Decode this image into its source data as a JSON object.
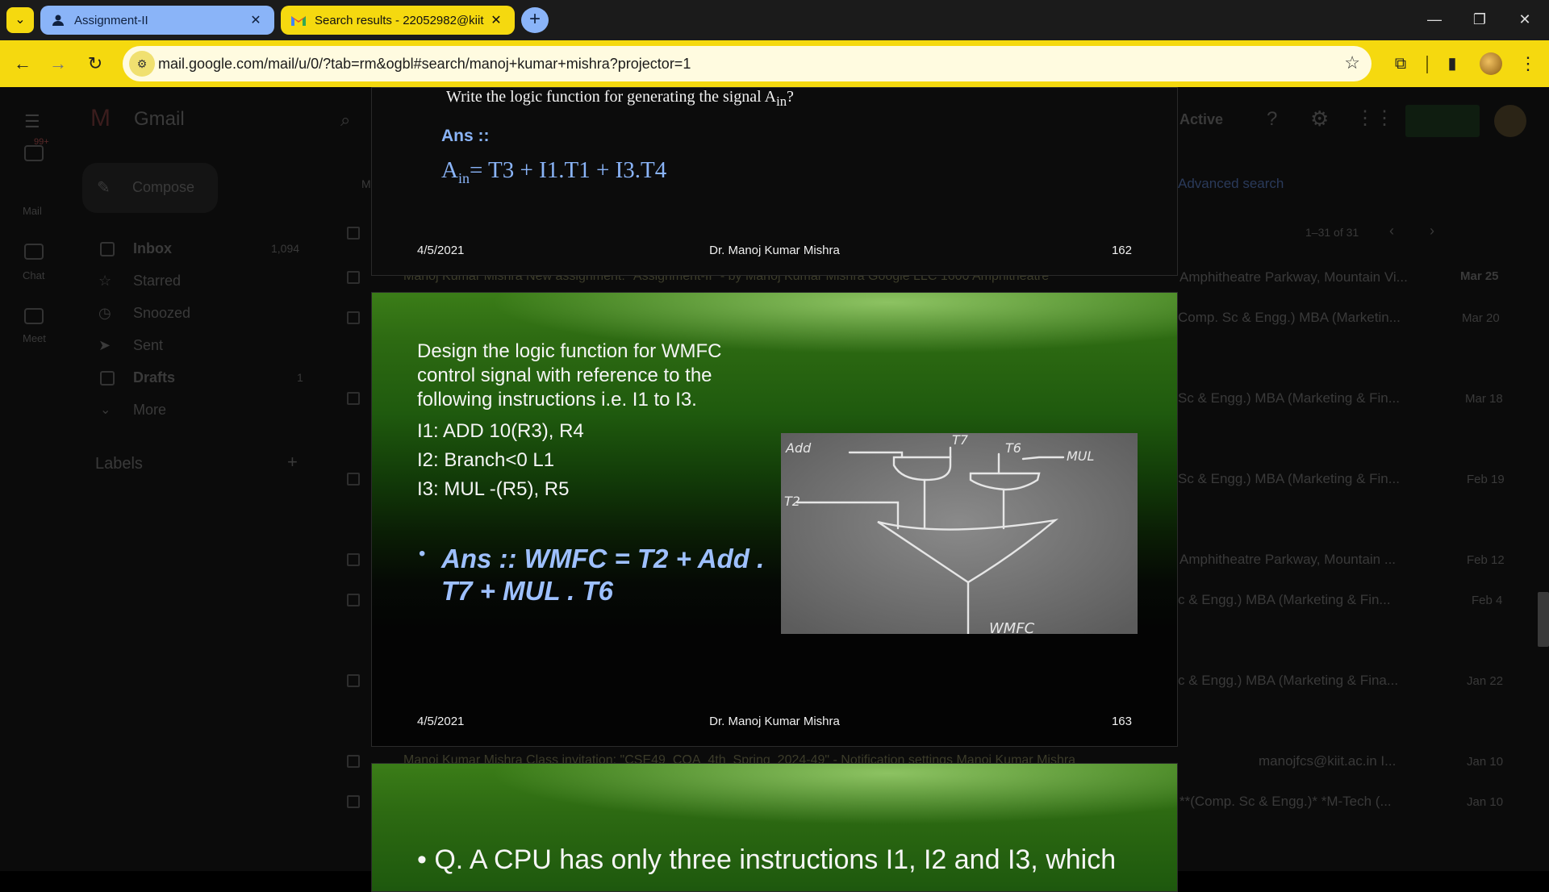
{
  "browser": {
    "tabs": [
      {
        "title": "Assignment-II",
        "icon": "person-icon",
        "active": false
      },
      {
        "title": "Search results - 22052982@kiit",
        "icon": "gmail-icon",
        "active": true
      }
    ],
    "url": "mail.google.com/mail/u/0/?tab=rm&ogbl#search/manoj+kumar+mishra?projector=1",
    "accent_color": "#f5d90f"
  },
  "gmail_bg": {
    "logo": "Gmail",
    "rail": [
      {
        "label": "Mail",
        "badge": "99+"
      },
      {
        "label": "Chat"
      },
      {
        "label": "Meet"
      }
    ],
    "compose": "Compose",
    "nav": [
      {
        "label": "Inbox",
        "count": "1,094"
      },
      {
        "label": "Starred",
        "count": ""
      },
      {
        "label": "Snoozed",
        "count": ""
      },
      {
        "label": "Sent",
        "count": ""
      },
      {
        "label": "Drafts",
        "count": "1"
      },
      {
        "label": "More",
        "count": ""
      }
    ],
    "labels_heading": "Labels",
    "status": "Active",
    "advanced_search": "Advanced search",
    "pagination": "1–31 of 31",
    "row_fragments": [
      "Amphitheatre Parkway, Mountain Vi...",
      "Comp. Sc & Engg.) MBA (Marketin...",
      "Sc & Engg.) MBA (Marketing & Fin...",
      "Sc & Engg.) MBA (Marketing & Fin...",
      "Amphitheatre Parkway, Mountain ...",
      "c & Engg.) MBA (Marketing & Fin...",
      "c & Engg.) MBA (Marketing & Fina...",
      "manojfcs@kiit.ac.in I...",
      "**(Comp. Sc & Engg.)* *M-Tech (..."
    ],
    "dates": [
      "Mar 25",
      "Mar 20",
      "Mar 18",
      "Feb 19",
      "Feb 12",
      "Feb 4",
      "Jan 22",
      "Jan 10",
      "Jan 10"
    ],
    "mid_row_1": "Manoj Kumar Mishra   New assignment: \"Assignment-II\" - by Manoj Kumar Mishra Google LLC 1600 Amphitheatre",
    "mid_row_2": "Manoj Kumar Mishra   Class invitation: \"CSE49_COA_4th_Spring_2024-49\" - Notification settings Manoj Kumar Mishra"
  },
  "slides": [
    {
      "question": "Write the logic function for generating the signal A",
      "question_sub": "in",
      "question_end": "?",
      "ans_label": "Ans ::",
      "eq_lhs": "A",
      "eq_sub": "in",
      "eq_rhs": "= T3 + I1.T1 + I3.T4",
      "date": "4/5/2021",
      "author": "Dr. Manoj Kumar Mishra",
      "page": "162"
    },
    {
      "body": "Design the logic function for WMFC control signal with reference to the following instructions i.e. I1 to I3.",
      "i1": "I1: ADD  10(R3), R4",
      "i2": "I2: Branch<0  L1",
      "i3": "I3: MUL  -(R5), R5",
      "bullet": "•",
      "answer": "Ans :: WMFC = T2 + Add . T7 + MUL . T6",
      "diagram": {
        "labels": [
          "Add",
          "T7",
          "T6",
          "MUL",
          "T2",
          "WMFC"
        ]
      },
      "date": "4/5/2021",
      "author": "Dr. Manoj Kumar Mishra",
      "page": "163"
    },
    {
      "text": "• Q. A CPU has only three instructions I1, I2 and I3, which"
    }
  ]
}
